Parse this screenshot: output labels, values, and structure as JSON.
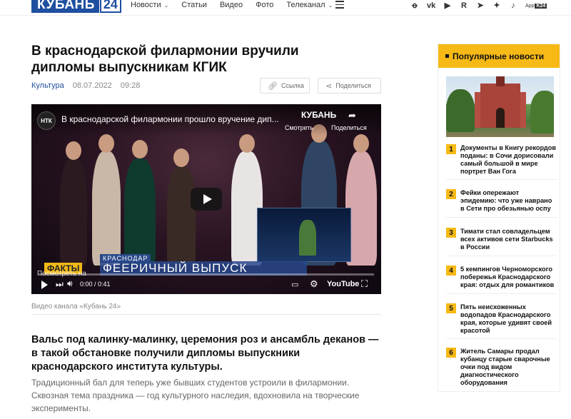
{
  "header": {
    "logo_text": "КУБАНЬ",
    "logo_num": "24",
    "nav": [
      {
        "label": "Новости",
        "has_dropdown": true
      },
      {
        "label": "Статьи",
        "has_dropdown": false
      },
      {
        "label": "Видео",
        "has_dropdown": false
      },
      {
        "label": "Фото",
        "has_dropdown": false
      },
      {
        "label": "Телеканал",
        "has_dropdown": true
      }
    ],
    "social_icons": [
      "odnoklassniki-icon",
      "vk-icon",
      "youtube-icon",
      "rutube-icon",
      "telegram-icon",
      "dzen-icon",
      "tiktok-icon"
    ],
    "app_label": "App",
    "app_badge": "K24"
  },
  "article": {
    "title": "В краснодарской филармонии вручили дипломы выпускникам КГИК",
    "category": "Культура",
    "date": "08.07.2022",
    "time": "09:28",
    "link_button": "Ссылка",
    "share_button": "Поделиться",
    "video": {
      "channel_badge": "НТК",
      "title": "В краснодарской филармонии прошло вручение дип...",
      "brand": "КУБАНЬ",
      "watch_label": "Смотреть",
      "share_label": "Поделиться",
      "lower_city": "КРАСНОДАР",
      "lower_facts": "ФАКТЫ",
      "lower_main": "ФЕЕРИЧНЫЙ ВЫПУСК",
      "watch_on": "Посмотреть на",
      "time": "0:00 / 0:41",
      "youtube_label": "YouTube"
    },
    "caption": "Видео канала «Кубань 24»",
    "lead": "Вальс под калинку-малинку, церемония роз и ансамбль деканов — в такой обстановке получили дипломы выпускники краснодарского института культуры.",
    "body": "Традиционный бал для теперь уже бывших студентов устроили в филармонии. Сквозная тема праздника — год культурного наследия, вдохновила на творческие эксперименты."
  },
  "sidebar": {
    "title": "Популярные новости",
    "news": [
      {
        "num": "1",
        "text": "Документы в Книгу рекордов поданы: в Сочи дорисовали самый большой в мире портрет Ван Гога"
      },
      {
        "num": "2",
        "text": "Фейки опережают эпидемию: что уже наврано в Сети про обезьянью оспу"
      },
      {
        "num": "3",
        "text": "Тимати стал совладельцем всех активов сети Starbucks в России"
      },
      {
        "num": "4",
        "text": "5 кемпингов Черноморского побережья Краснодарского края: отдых для романтиков"
      },
      {
        "num": "5",
        "text": "Пять неисхоженных водопадов Краснодарского края, которые удивят своей красотой"
      },
      {
        "num": "6",
        "text": "Житель Самары продал кубанцу старые сварочные очки под видом диагностического оборудования"
      }
    ]
  }
}
